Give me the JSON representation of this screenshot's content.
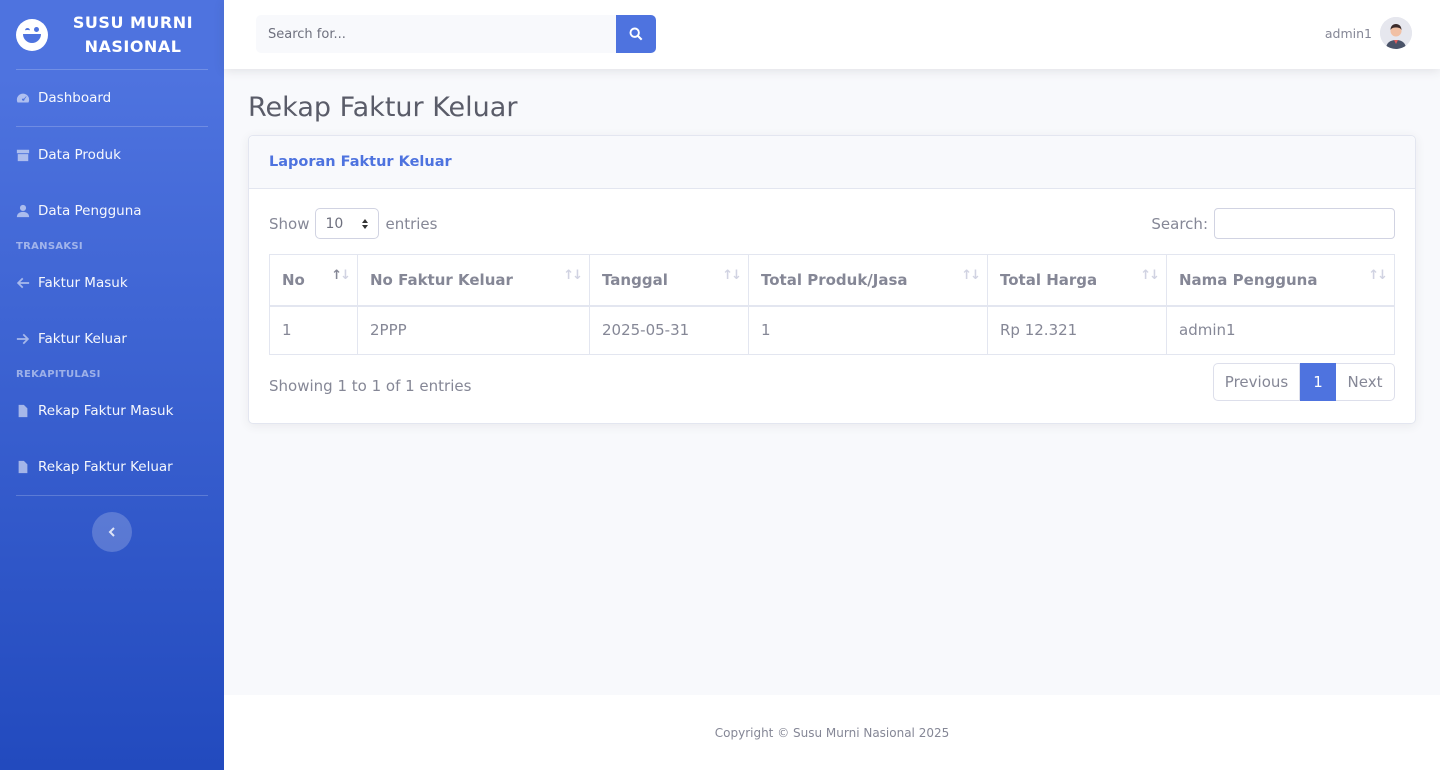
{
  "brand": {
    "name": "SUSU MURNI NASIONAL",
    "logo_icon": "laugh-wink-icon"
  },
  "sidebar": {
    "items": [
      {
        "label": "Dashboard",
        "icon": "tachometer-icon"
      },
      {
        "label": "Data Produk",
        "icon": "box-icon"
      },
      {
        "label": "Data Pengguna",
        "icon": "user-icon"
      }
    ],
    "heading_transaksi": "TRANSAKSI",
    "transaksi_items": [
      {
        "label": "Faktur Masuk",
        "icon": "arrow-left-icon"
      },
      {
        "label": "Faktur Keluar",
        "icon": "arrow-right-icon"
      }
    ],
    "heading_rekap": "REKAPITULASI",
    "rekap_items": [
      {
        "label": "Rekap Faktur Masuk",
        "icon": "file-icon"
      },
      {
        "label": "Rekap Faktur Keluar",
        "icon": "file-icon"
      }
    ],
    "toggle_icon": "chevron-left-icon"
  },
  "topbar": {
    "search_placeholder": "Search for...",
    "search_icon": "search-icon",
    "user_name": "admin1"
  },
  "page": {
    "title": "Rekap Faktur Keluar"
  },
  "card": {
    "title": "Laporan Faktur Keluar",
    "show_label": "Show",
    "length_value": "10",
    "entries_label": "entries",
    "search_label": "Search:",
    "columns": [
      "No",
      "No Faktur Keluar",
      "Tanggal",
      "Total Produk/Jasa",
      "Total Harga",
      "Nama Pengguna"
    ],
    "rows": [
      [
        "1",
        "2PPP",
        "2025-05-31",
        "1",
        "Rp 12.321",
        "admin1"
      ]
    ],
    "info": "Showing 1 to 1 of 1 entries",
    "pager": {
      "previous": "Previous",
      "current": "1",
      "next": "Next"
    }
  },
  "footer": {
    "text": "Copyright © Susu Murni Nasional 2025"
  },
  "colors": {
    "primary": "#4e73df",
    "primary_dark": "#224abe",
    "text": "#858796"
  }
}
